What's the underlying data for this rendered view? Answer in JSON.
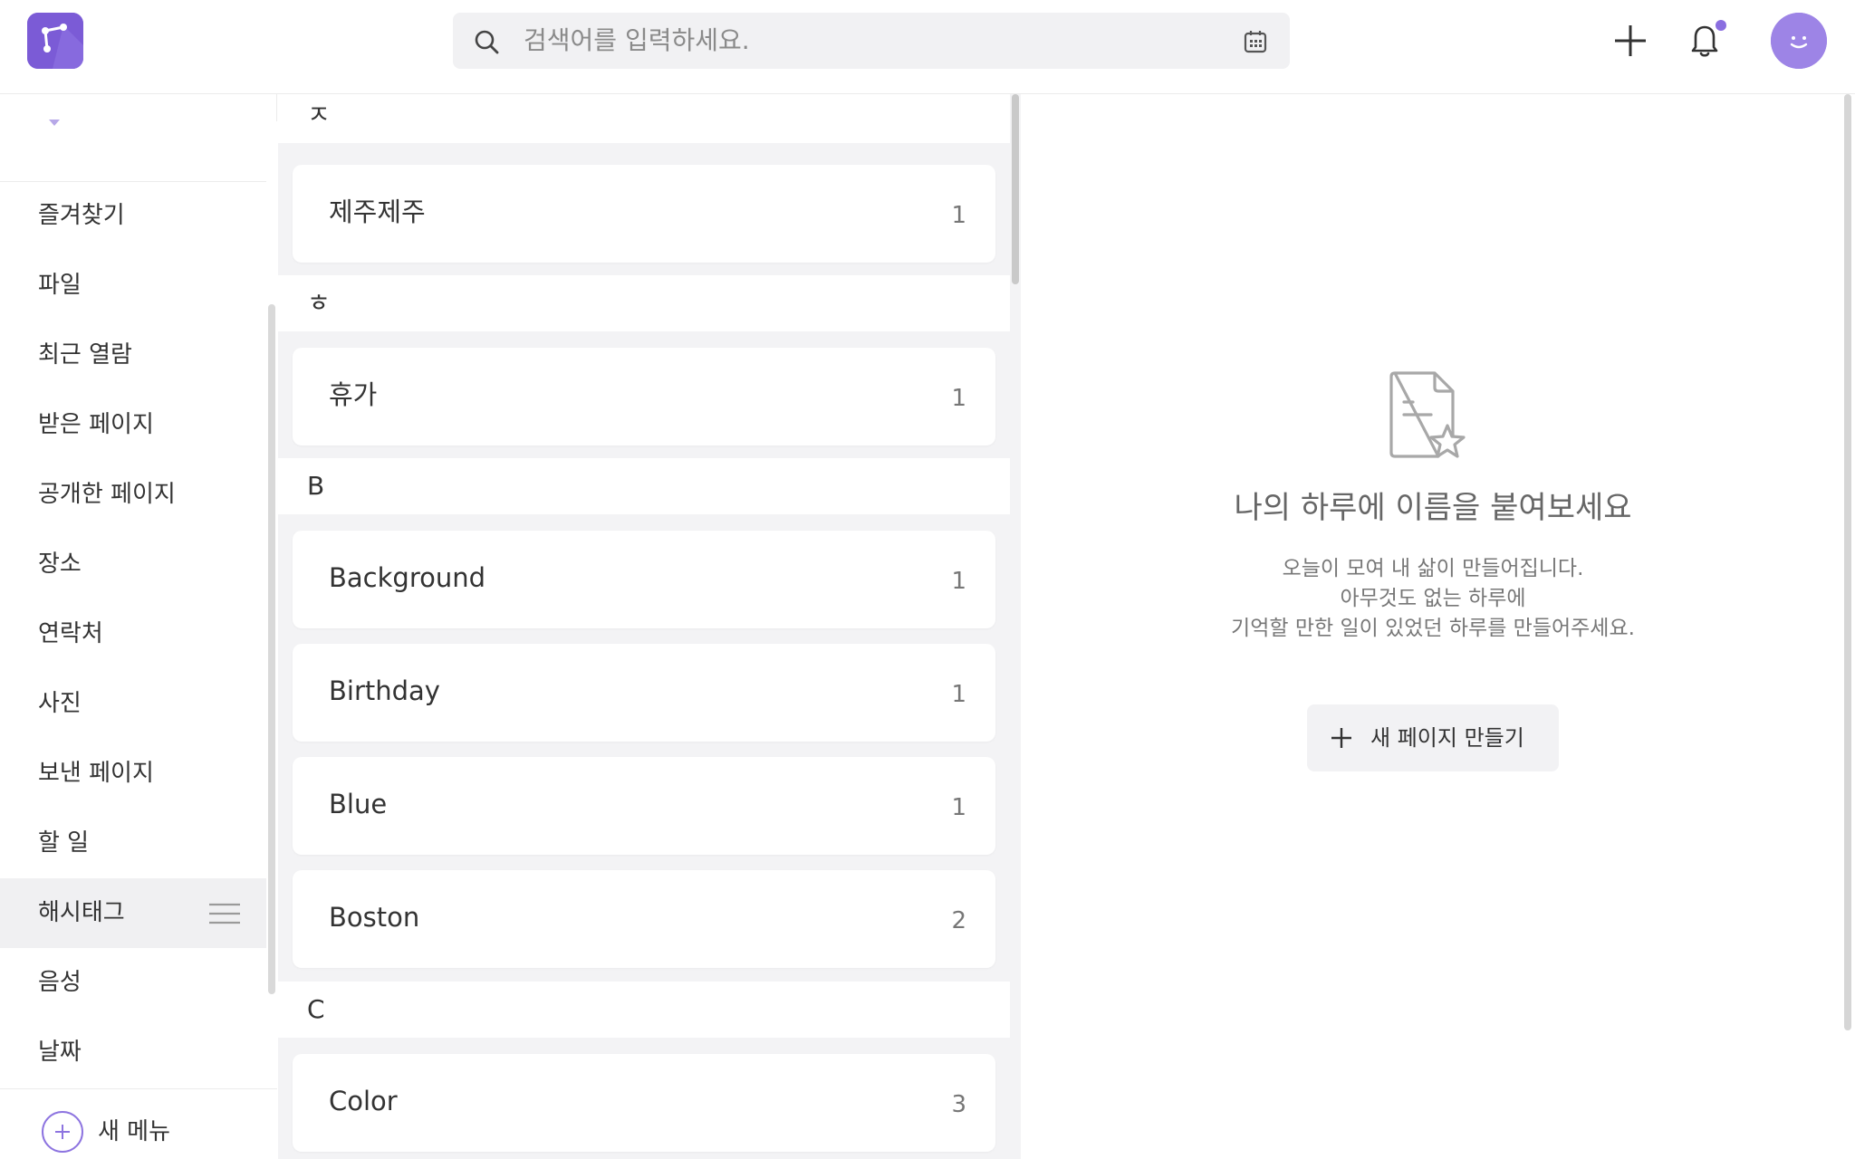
{
  "search": {
    "placeholder": "검색어를 입력하세요."
  },
  "sidebar": {
    "items": [
      {
        "label": "즐겨찾기"
      },
      {
        "label": "파일"
      },
      {
        "label": "최근 열람"
      },
      {
        "label": "받은 페이지"
      },
      {
        "label": "공개한 페이지"
      },
      {
        "label": "장소"
      },
      {
        "label": "연락처"
      },
      {
        "label": "사진"
      },
      {
        "label": "보낸 페이지"
      },
      {
        "label": "할 일"
      },
      {
        "label": "해시태그",
        "active": true
      },
      {
        "label": "음성"
      },
      {
        "label": "날짜"
      }
    ],
    "footer_label": "새 메뉴"
  },
  "hashtags": {
    "groups": [
      {
        "header": "ㅈ",
        "tags": [
          {
            "name": "제주제주",
            "count": "1"
          }
        ]
      },
      {
        "header": "ㅎ",
        "tags": [
          {
            "name": "휴가",
            "count": "1"
          }
        ]
      },
      {
        "header": "B",
        "tags": [
          {
            "name": "Background",
            "count": "1"
          },
          {
            "name": "Birthday",
            "count": "1"
          },
          {
            "name": "Blue",
            "count": "1"
          },
          {
            "name": "Boston",
            "count": "2"
          }
        ]
      },
      {
        "header": "C",
        "tags": [
          {
            "name": "Color",
            "count": "3"
          }
        ]
      }
    ]
  },
  "detail": {
    "title": "나의 하루에 이름을 붙여보세요",
    "desc_line1": "오늘이 모여 내 삶이 만들어집니다.",
    "desc_line2": "아무것도 없는 하루에",
    "desc_line3": "기억할 만한 일이 있었던 하루를 만들어주세요.",
    "button_label": "새 페이지 만들기"
  },
  "colors": {
    "brand": "#7b5bd6",
    "avatar": "#9d84e6",
    "notification_dot": "#8a6ee0"
  },
  "icons": {
    "logo": "share-node-logo",
    "search": "search-icon",
    "calendar": "calendar-icon",
    "add": "plus-icon",
    "notifications": "bell-icon",
    "avatar": "smiley-avatar",
    "reorder": "hamburger-menu-icon",
    "empty_state": "document-star-icon"
  }
}
